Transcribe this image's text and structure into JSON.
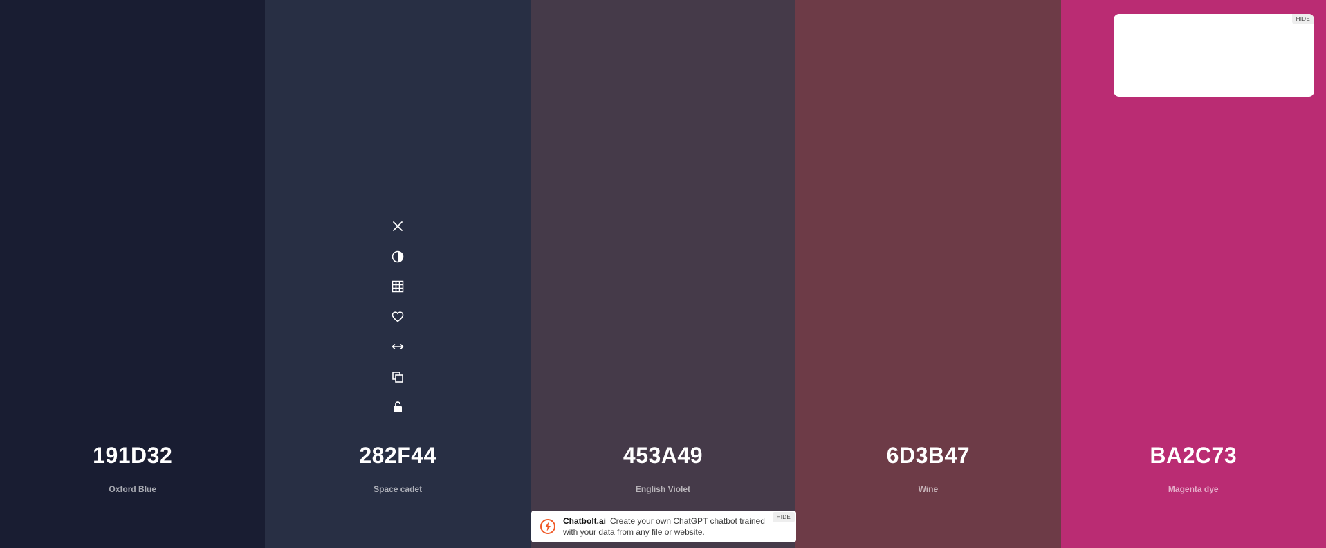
{
  "swatches": [
    {
      "hex": "191D32",
      "name": "Oxford Blue",
      "color": "#191D32"
    },
    {
      "hex": "282F44",
      "name": "Space cadet",
      "color": "#282F44"
    },
    {
      "hex": "453A49",
      "name": "English Violet",
      "color": "#453A49"
    },
    {
      "hex": "6D3B47",
      "name": "Wine",
      "color": "#6D3B47"
    },
    {
      "hex": "BA2C73",
      "name": "Magenta dye",
      "color": "#BA2C73"
    }
  ],
  "toolbar": {
    "icons": [
      "close-icon",
      "contrast-icon",
      "grid-icon",
      "heart-icon",
      "arrows-horizontal-icon",
      "copy-icon",
      "unlock-icon"
    ]
  },
  "ad_box": {
    "hide_label": "HIDE"
  },
  "banner": {
    "brand": "Chatbolt.ai",
    "text": "Create your own ChatGPT chatbot trained with your data from any file or website.",
    "hide_label": "HIDE",
    "accent": "#F05A28"
  }
}
